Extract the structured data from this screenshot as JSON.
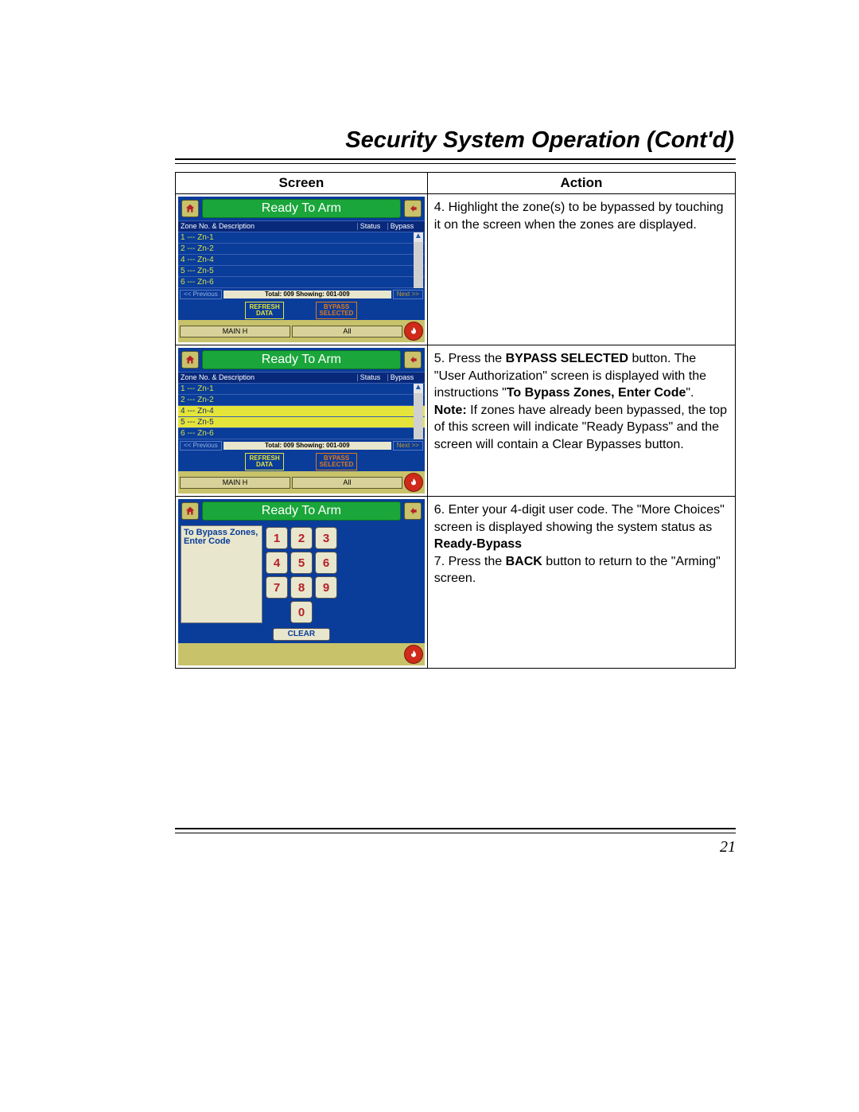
{
  "heading": "Security System Operation (Cont'd)",
  "page_number": "21",
  "table": {
    "col_screen": "Screen",
    "col_action": "Action"
  },
  "actions": {
    "step4": "4.   Highlight the zone(s) to be bypassed by touching it on the screen when the zones are displayed.",
    "step5_a": "5.   Press the ",
    "step5_bold1": "BYPASS SELECTED",
    "step5_b": " button.  The \"User Authorization\" screen is displayed with the instructions \"",
    "step5_bold2": "To Bypass Zones, Enter Code",
    "step5_c": "\".",
    "step5_note_label": "Note:",
    "step5_note": " If zones have already been bypassed, the top of this screen will indicate \"Ready Bypass\" and the screen will contain a Clear Bypasses button.",
    "step6_a": "6.   Enter your 4-digit user code.  The \"More Choices\" screen is displayed showing the system status as ",
    "step6_bold": "Ready-Bypass",
    "step7_a": "7. Press the ",
    "step7_bold": "BACK",
    "step7_b": " button to return to the \"Arming\" screen."
  },
  "device": {
    "status": "Ready To Arm",
    "header_zone": "Zone No. & Description",
    "header_status": "Status",
    "header_bypass": "Bypass",
    "zones": [
      "1 --- Zn-1",
      "2 --- Zn-2",
      "4 --- Zn-4",
      "5 --- Zn-5",
      "6 --- Zn-6"
    ],
    "prev": "<< Previous",
    "total": "Total: 009  Showing: 001-009",
    "next": "Next >>",
    "refresh_l1": "REFRESH",
    "refresh_l2": "DATA",
    "bypasssel_l1": "BYPASS",
    "bypasssel_l2": "SELECTED",
    "tab_main": "MAIN H",
    "tab_all": "All"
  },
  "keypad": {
    "msg_l1": "To Bypass Zones,",
    "msg_l2": "Enter Code",
    "keys": [
      [
        "1",
        "2",
        "3"
      ],
      [
        "4",
        "5",
        "6"
      ],
      [
        "7",
        "8",
        "9"
      ],
      [
        "0"
      ]
    ],
    "clear": "CLEAR"
  }
}
